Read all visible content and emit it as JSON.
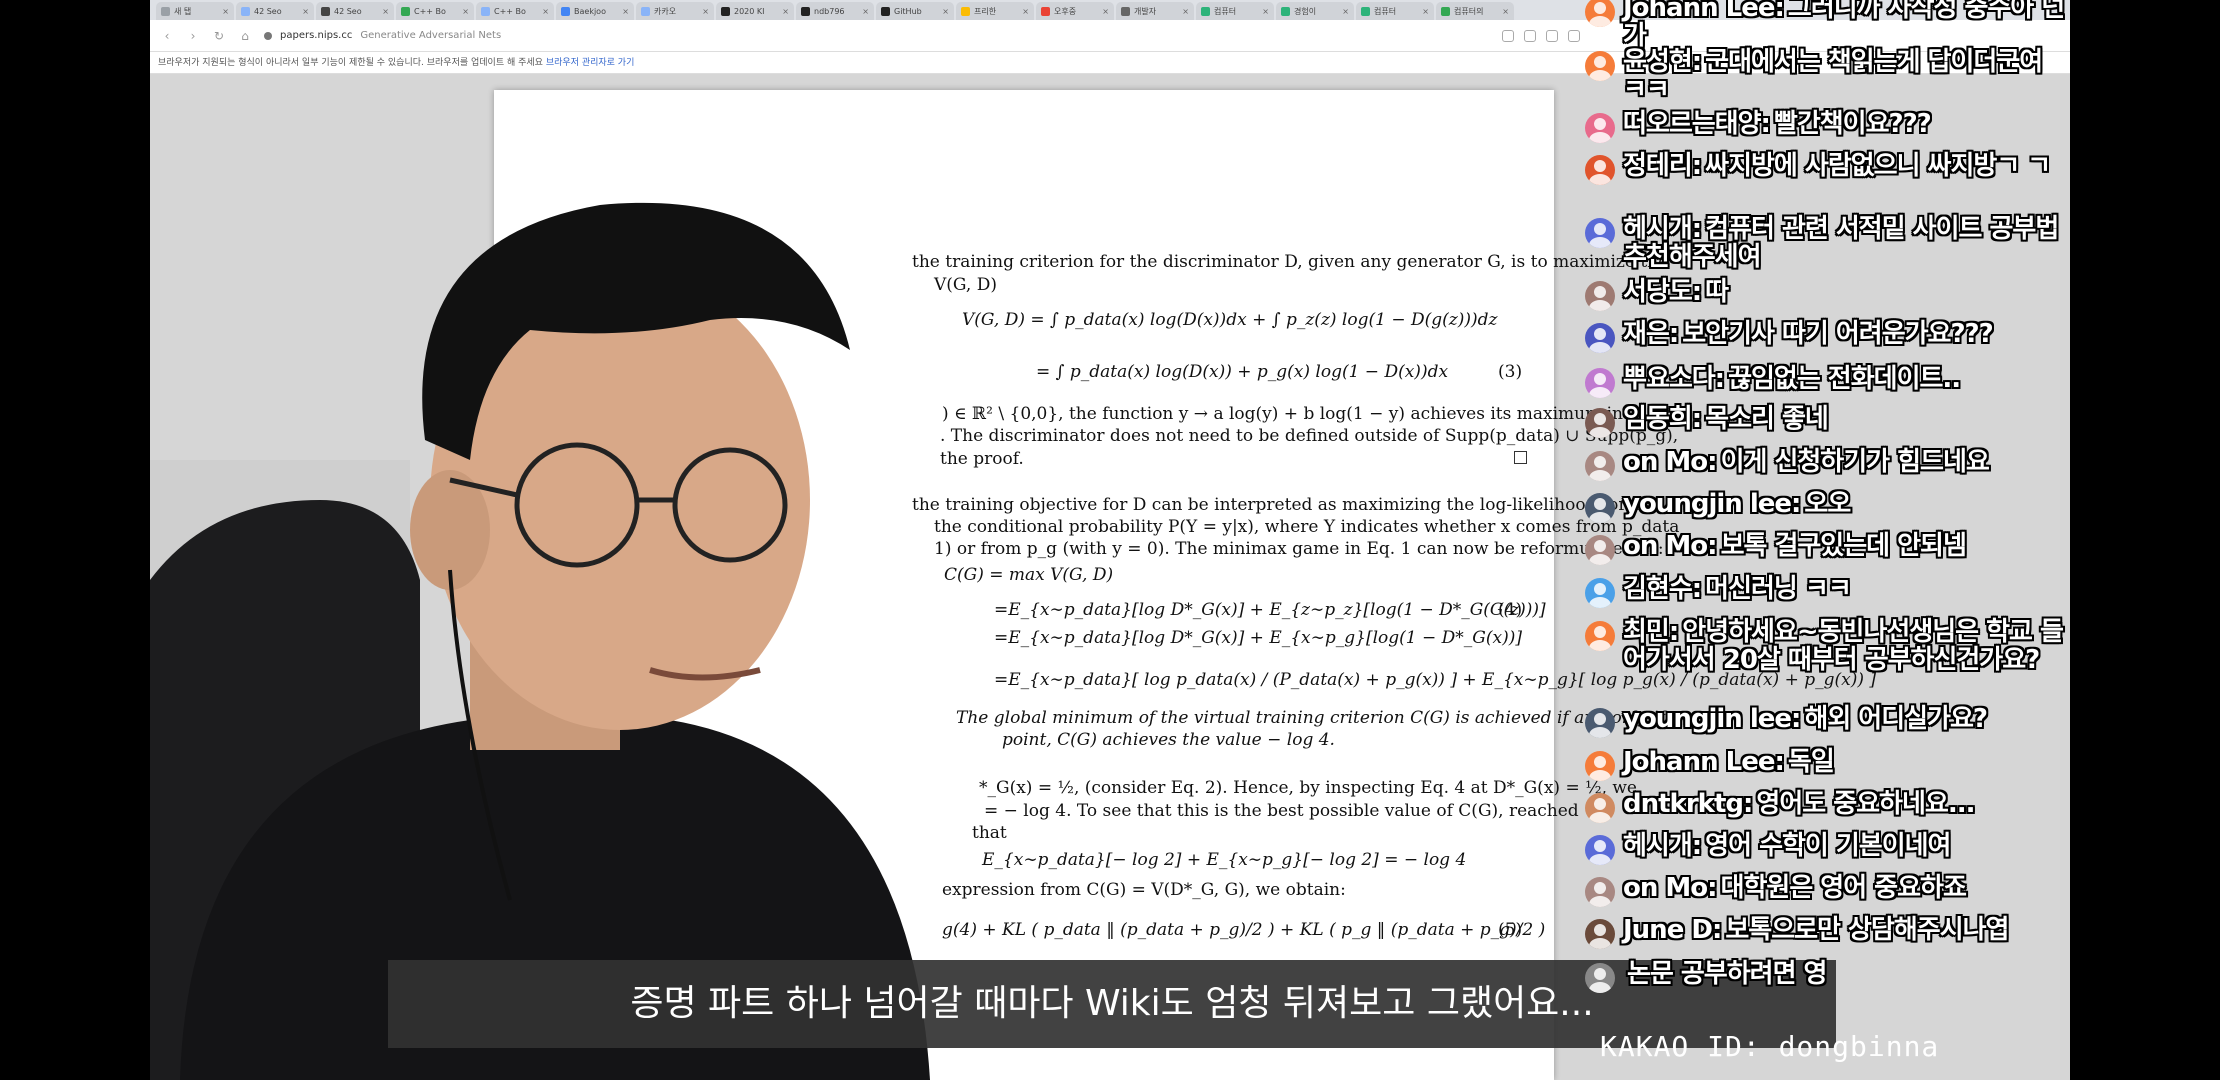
{
  "browser": {
    "tabs": [
      {
        "label": "새 탭",
        "color": "#9aa0a6"
      },
      {
        "label": "42 Seo",
        "color": "#8ab4f8"
      },
      {
        "label": "42 Seo",
        "color": "#444444"
      },
      {
        "label": "C++ Bo",
        "color": "#34a853"
      },
      {
        "label": "C++ Bo",
        "color": "#8ab4f8"
      },
      {
        "label": "Baekjoo",
        "color": "#4285f4"
      },
      {
        "label": "카카오",
        "color": "#8ab4f8"
      },
      {
        "label": "2020 KI",
        "color": "#222222"
      },
      {
        "label": "ndb796",
        "color": "#222222"
      },
      {
        "label": "GitHub",
        "color": "#222222"
      },
      {
        "label": "프리한",
        "color": "#fbbc04"
      },
      {
        "label": "오후중",
        "color": "#ea4335"
      },
      {
        "label": "개발자",
        "color": "#666666"
      },
      {
        "label": "컴퓨터",
        "color": "#2db37a"
      },
      {
        "label": "경험이",
        "color": "#2db37a"
      },
      {
        "label": "컴퓨터",
        "color": "#2db37a"
      },
      {
        "label": "컴퓨터의",
        "color": "#34a853"
      }
    ],
    "url": "papers.nips.cc",
    "page_title": "Generative Adversarial Nets",
    "infobar_text": "브라우저가 지원되는 형식이 아니라서 일부 기능이 제한될 수 있습니다. 브라우저를 업데이트 해 주세요",
    "infobar_link": "브라우저 관리자로 가기"
  },
  "paper": {
    "lines": {
      "l1": "the training criterion for the discriminator D, given any generator G, is to maximize the",
      "l2": "V(G, D)",
      "eq3a": "V(G, D) = ∫ p_data(x) log(D(x))dx + ∫ p_z(z) log(1 − D(g(z)))dz",
      "eq3b": "= ∫ p_data(x) log(D(x)) + p_g(x) log(1 − D(x))dx",
      "eq3num": "(3)",
      "l3": ") ∈ ℝ² \\ {0,0}, the function y → a log(y) + b log(1 − y) achieves its maximum in",
      "l4": ". The discriminator does not need to be defined outside of Supp(p_data) ∪ Supp(p_g),",
      "l5": "the proof.",
      "l6": "the training objective for D can be interpreted as maximizing the log-likelihood for es-",
      "l7": "the conditional probability P(Y = y|x), where Y indicates whether x comes from p_data",
      "l8": "1) or from p_g (with y = 0). The minimax game in Eq. 1 can now be reformulated as:",
      "eq4a": "C(G) = max V(G, D)",
      "eq4b": "=E_{x∼p_data}[log D*_G(x)] + E_{z∼p_z}[log(1 − D*_G(G(z)))]",
      "eq4num": "(4)",
      "eq4c": "=E_{x∼p_data}[log D*_G(x)] + E_{x∼p_g}[log(1 − D*_G(x))]",
      "eq4d": "=E_{x∼p_data}[ log p_data(x) / (P_data(x) + p_g(x)) ] + E_{x∼p_g}[ log p_g(x) / (p_data(x) + p_g(x)) ]",
      "thm1": "The global minimum of the virtual training criterion C(G) is achieved if and only if",
      "thm2": "point, C(G) achieves the value − log 4.",
      "l9": "*_G(x) = ½, (consider Eq. 2). Hence, by inspecting Eq. 4 at D*_G(x) = ½, we",
      "l10": "= − log 4. To see that this is the best possible value of C(G), reached",
      "l11": "that",
      "eq5a": "E_{x∼p_data}[− log 2] + E_{x∼p_g}[− log 2] = − log 4",
      "l12": "expression from C(G) = V(D*_G, G), we obtain:",
      "eq5b": "g(4) + KL ( p_data ‖ (p_data + p_g)/2 ) + KL ( p_g ‖ (p_data + p_g)/2 )",
      "eq5num": "(5)"
    }
  },
  "subtitle": "증명 파트 하나 넘어갈 때마다 Wiki도 엄청 뒤져보고 그랬어요...",
  "chat": [
    {
      "name": "Johann Lee:",
      "text": "그러니까 사작성 중주아 넌가",
      "color": "#f57c3a"
    },
    {
      "name": "윤성현:",
      "text": "군대에서는 책읽는게 답이더군여 ㅋㅋ",
      "color": "#f57c3a"
    },
    {
      "name": "떠오르는태양:",
      "text": "빨간책이요???",
      "color": "#e86b8c"
    },
    {
      "name": "정테리:",
      "text": "싸지방에 사람없으니 싸지방ㄱ ㄱ",
      "color": "#e0542c"
    },
    {
      "name": "헤시개:",
      "text": "컴퓨터 관련 서적밑 사이트 공부법 추천해주세여",
      "color": "#5a6bd8"
    },
    {
      "name": "서당도:",
      "text": "따",
      "color": "#9e7a72"
    },
    {
      "name": "재은:",
      "text": "보안기사 따기 어려운가요???",
      "color": "#4a56c0"
    },
    {
      "name": "뿌요소다:",
      "text": "끊임없는 전화데이트..",
      "color": "#c07ad0"
    },
    {
      "name": "임동희:",
      "text": "목소리 좋네",
      "color": "#7a5a52"
    },
    {
      "name": "on Mo:",
      "text": "이게 신청하기가 힘드네요",
      "color": "#a88882"
    },
    {
      "name": "youngjin lee:",
      "text": "오오",
      "color": "#4a5a70"
    },
    {
      "name": "on Mo:",
      "text": "보톡 걸구있는데 안되넴",
      "color": "#a88882"
    },
    {
      "name": "김현수:",
      "text": "머신러닝 ㅋㅋ",
      "color": "#4aa0e8"
    },
    {
      "name": "최민:",
      "text": "안녕하세요~동빈나선생님은 학교 들어가서서 20살 때부터 공부하신건가요?",
      "color": "#f57c3a"
    },
    {
      "name": "youngjin lee:",
      "text": "해외 어디실가요?",
      "color": "#4a5a70"
    },
    {
      "name": "Johann Lee:",
      "text": "독일",
      "color": "#f57c3a"
    },
    {
      "name": "dntkrktg:",
      "text": "영어도 중요하네요...",
      "color": "#d08a60"
    },
    {
      "name": "헤시개:",
      "text": "영어 수학이 기본이네여",
      "color": "#5a6bd8"
    },
    {
      "name": "on Mo:",
      "text": "대학원은 영어 중요하죠",
      "color": "#a88882"
    },
    {
      "name": "June D:",
      "text": "보톡으로만 상담해주시나엽",
      "color": "#6a4a3a"
    },
    {
      "name": "",
      "text": "논문 공부하려면 영",
      "color": "#888888"
    }
  ],
  "kakao_text": "KAKAO ID: dongbinna"
}
